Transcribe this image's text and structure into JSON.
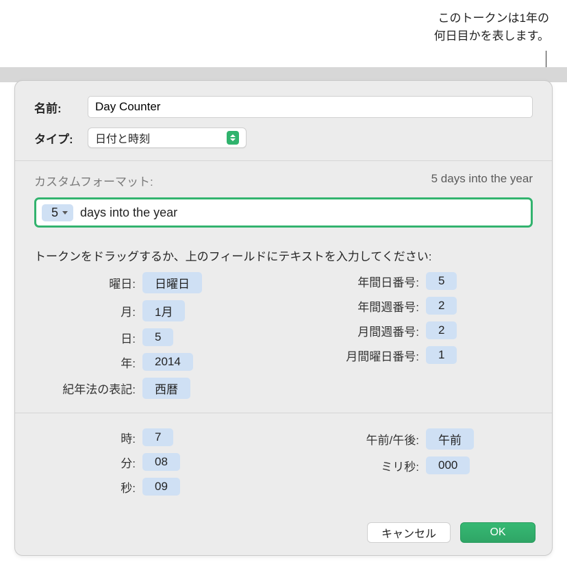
{
  "callout": {
    "line1": "このトークンは1年の",
    "line2": "何日目かを表します。"
  },
  "dialog": {
    "name_label": "名前:",
    "name_value": "Day Counter",
    "type_label": "タイプ:",
    "type_value": "日付と時刻",
    "custom_format_label": "カスタムフォーマット:",
    "custom_format_preview": "5 days into the year",
    "format_token_value": "5",
    "format_text_after": "days into the year",
    "drag_hint": "トークンをドラッグするか、上のフィールドにテキストを入力してください:",
    "date_tokens_left": [
      {
        "label": "曜日:",
        "value": "日曜日"
      },
      {
        "label": "月:",
        "value": "1月"
      },
      {
        "label": "日:",
        "value": "5"
      },
      {
        "label": "年:",
        "value": "2014"
      },
      {
        "label": "紀年法の表記:",
        "value": "西暦"
      }
    ],
    "date_tokens_right": [
      {
        "label": "年間日番号:",
        "value": "5"
      },
      {
        "label": "年間週番号:",
        "value": "2"
      },
      {
        "label": "月間週番号:",
        "value": "2"
      },
      {
        "label": "月間曜日番号:",
        "value": "1"
      }
    ],
    "time_tokens_left": [
      {
        "label": "時:",
        "value": "7"
      },
      {
        "label": "分:",
        "value": "08"
      },
      {
        "label": "秒:",
        "value": "09"
      }
    ],
    "time_tokens_right": [
      {
        "label": "午前/午後:",
        "value": "午前"
      },
      {
        "label": "ミリ秒:",
        "value": "000"
      }
    ],
    "cancel_label": "キャンセル",
    "ok_label": "OK"
  }
}
